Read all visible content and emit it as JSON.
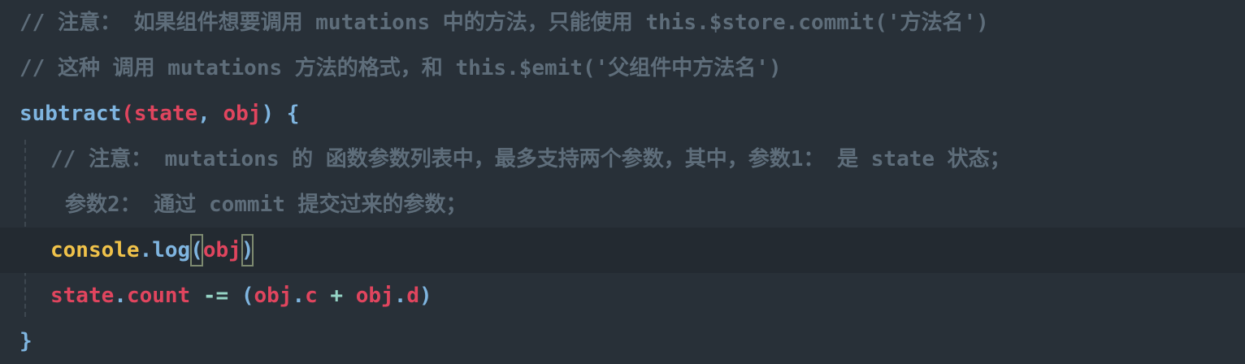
{
  "editor": {
    "colors": {
      "background": "#283038",
      "active_line": "#232a31",
      "comment": "#5e6d7a",
      "function": "#7fb5e0",
      "variable": "#e0455e",
      "object": "#f0c24a"
    },
    "lines": [
      {
        "tokens": [
          "// 注意： 如果组件想要调用 mutations 中的方法，只能使用 this.$store.commit('方法名')"
        ]
      },
      {
        "tokens": [
          "// 这种 调用 mutations 方法的格式，和 this.$emit('父组件中方法名')"
        ]
      },
      {
        "tokens": [
          "subtract",
          "(",
          "state",
          ", ",
          "obj",
          ") {"
        ]
      },
      {
        "tokens": [
          "// 注意： mutations 的 函数参数列表中，最多支持两个参数，其中，参数1： 是 state 状态；"
        ]
      },
      {
        "tokens": [
          "参数2： 通过 commit 提交过来的参数；"
        ]
      },
      {
        "tokens": [
          "console",
          ".",
          "log",
          "(",
          "obj",
          ")"
        ]
      },
      {
        "tokens": [
          "state",
          ".",
          "count",
          " -= ",
          "(",
          "obj",
          ".",
          "c",
          " + ",
          "obj",
          ".",
          "d",
          ")"
        ]
      },
      {
        "tokens": [
          "}"
        ]
      }
    ]
  }
}
